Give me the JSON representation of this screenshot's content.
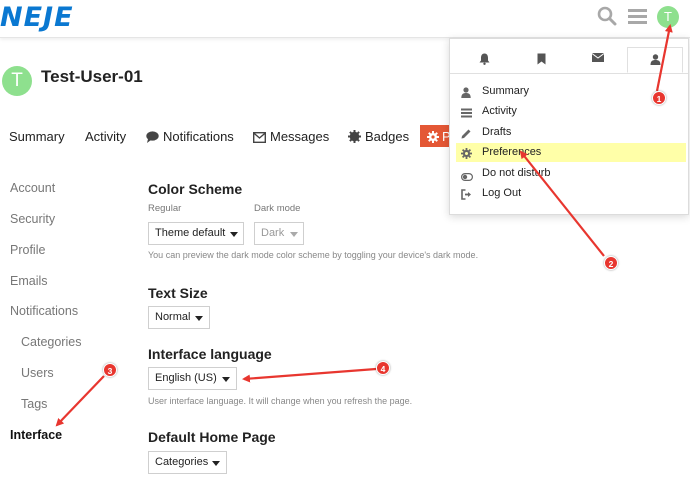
{
  "brand": {
    "logo_text": "NEJE"
  },
  "header": {
    "icons": [
      "search-icon",
      "hamburger-icon"
    ],
    "avatar_letter": "T"
  },
  "user": {
    "avatar_letter": "T",
    "name": "Test-User-01"
  },
  "nav": {
    "tabs": [
      {
        "label": "Summary"
      },
      {
        "label": "Activity"
      },
      {
        "label": "Notifications",
        "icon": "comment-icon"
      },
      {
        "label": "Messages",
        "icon": "envelope-icon"
      },
      {
        "label": "Badges",
        "icon": "badge-icon"
      },
      {
        "label": "P",
        "icon": "gear-icon"
      }
    ]
  },
  "sidebar": {
    "items": [
      {
        "label": "Account"
      },
      {
        "label": "Security"
      },
      {
        "label": "Profile"
      },
      {
        "label": "Emails"
      },
      {
        "label": "Notifications"
      },
      {
        "label": "Categories"
      },
      {
        "label": "Users"
      },
      {
        "label": "Tags"
      },
      {
        "label": "Interface",
        "active": true
      }
    ]
  },
  "content": {
    "color_scheme": {
      "title": "Color Scheme",
      "regular_label": "Regular",
      "dark_label": "Dark mode",
      "regular_value": "Theme default",
      "dark_value": "Dark",
      "hint": "You can preview the dark mode color scheme by toggling your device's dark mode."
    },
    "text_size": {
      "title": "Text Size",
      "value": "Normal"
    },
    "language": {
      "title": "Interface language",
      "value": "English (US)",
      "hint": "User interface language. It will change when you refresh the page."
    },
    "home_page": {
      "title": "Default Home Page",
      "value": "Categories"
    }
  },
  "user_menu": {
    "tabs": [
      "bell-icon",
      "bookmark-icon",
      "envelope-icon",
      "user-icon"
    ],
    "items": [
      {
        "label": "Summary",
        "icon": "user-icon"
      },
      {
        "label": "Activity",
        "icon": "list-icon"
      },
      {
        "label": "Drafts",
        "icon": "pencil-icon"
      },
      {
        "label": "Preferences",
        "icon": "gear-icon",
        "highlighted": true
      },
      {
        "label": "Do not disturb",
        "icon": "toggle-icon"
      },
      {
        "label": "Log Out",
        "icon": "sign-out-icon"
      }
    ]
  },
  "annotations": {
    "markers": [
      "1",
      "2",
      "3",
      "4"
    ]
  },
  "colors": {
    "brand_blue": "#0a78d1",
    "avatar_green": "#8ee08e",
    "active_tab": "#e45735",
    "highlight": "#ffffa8",
    "marker_red": "#e8362f"
  }
}
